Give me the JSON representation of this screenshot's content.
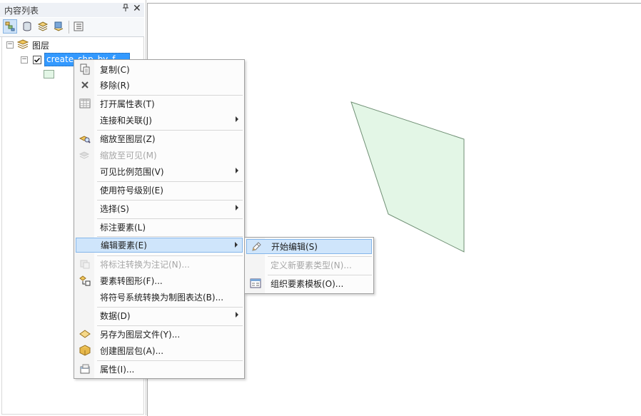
{
  "toc": {
    "title": "内容列表",
    "pin_glyph": "↕",
    "close_glyph": "✕",
    "tree": {
      "root_label": "图层",
      "layer_label": "create_shp_by_f..."
    }
  },
  "context_menu": {
    "items": [
      {
        "label": "复制(C)",
        "icon": "copy-icon",
        "disabled": false
      },
      {
        "label": "移除(R)",
        "icon": "remove-icon",
        "disabled": false
      },
      {
        "label": "打开属性表(T)",
        "icon": "table-icon",
        "disabled": false
      },
      {
        "label": "连接和关联(J)",
        "icon": "",
        "disabled": false,
        "submenu": true
      },
      {
        "label": "缩放至图层(Z)",
        "icon": "zoom-layer-icon",
        "disabled": false
      },
      {
        "label": "缩放至可见(M)",
        "icon": "zoom-visible-icon",
        "disabled": true
      },
      {
        "label": "可见比例范围(V)",
        "icon": "",
        "disabled": false,
        "submenu": true
      },
      {
        "label": "使用符号级别(E)",
        "icon": "",
        "disabled": false
      },
      {
        "label": "选择(S)",
        "icon": "",
        "disabled": false,
        "submenu": true
      },
      {
        "label": "标注要素(L)",
        "icon": "",
        "disabled": false
      },
      {
        "label": "编辑要素(E)",
        "icon": "",
        "disabled": false,
        "submenu": true,
        "highlighted": true
      },
      {
        "label": "将标注转换为注记(N)...",
        "icon": "convert-label-icon",
        "disabled": true
      },
      {
        "label": "要素转图形(F)...",
        "icon": "feature-graphic-icon",
        "disabled": false
      },
      {
        "label": "将符号系统转换为制图表达(B)...",
        "icon": "",
        "disabled": false
      },
      {
        "label": "数据(D)",
        "icon": "",
        "disabled": false,
        "submenu": true
      },
      {
        "label": "另存为图层文件(Y)...",
        "icon": "layer-file-icon",
        "disabled": false
      },
      {
        "label": "创建图层包(A)...",
        "icon": "layer-package-icon",
        "disabled": false
      },
      {
        "label": "属性(I)...",
        "icon": "properties-icon",
        "disabled": false
      }
    ]
  },
  "submenu": {
    "items": [
      {
        "label": "开始编辑(S)",
        "icon": "start-edit-icon",
        "disabled": false,
        "highlighted": true
      },
      {
        "label": "定义新要素类型(N)...",
        "icon": "",
        "disabled": true
      },
      {
        "label": "组织要素模板(O)...",
        "icon": "organize-templates-icon",
        "disabled": false
      }
    ]
  },
  "colors": {
    "polygon_fill": "#e3f6e6",
    "polygon_stroke": "#6f8f74",
    "selection": "#3399ff",
    "menu_highlight": "#cfe5fb"
  }
}
